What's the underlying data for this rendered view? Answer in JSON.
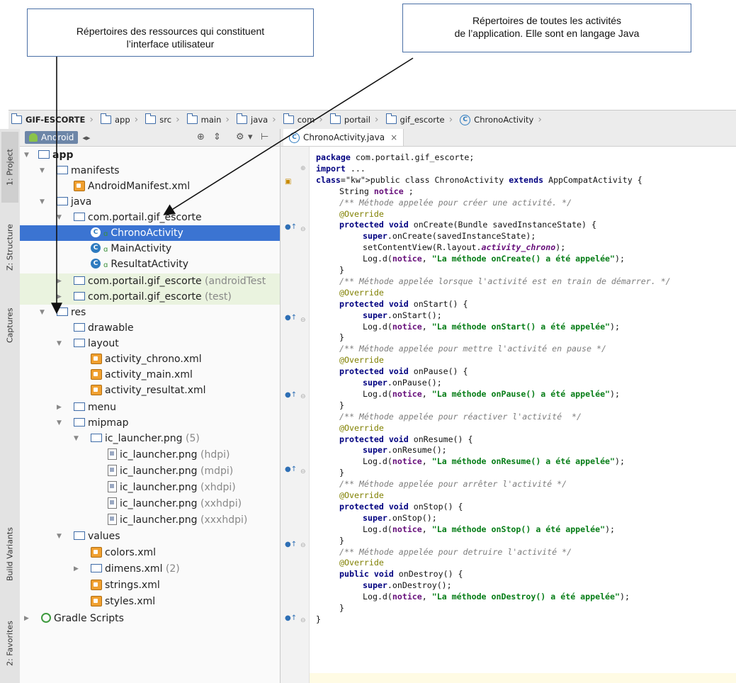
{
  "callouts": {
    "left": [
      "Répertoires des ressources qui constituent",
      "l’interface utilisateur"
    ],
    "right": [
      "Répertoires de toutes les activités",
      "de l’application. Elle sont en langage Java"
    ]
  },
  "breadcrumb": [
    {
      "label": "GIF-ESCORTE",
      "icon": "folder-icon"
    },
    {
      "label": "app",
      "icon": "folder-icon"
    },
    {
      "label": "src",
      "icon": "folder-icon"
    },
    {
      "label": "main",
      "icon": "folder-icon"
    },
    {
      "label": "java",
      "icon": "folder-icon"
    },
    {
      "label": "com",
      "icon": "folder-icon"
    },
    {
      "label": "portail",
      "icon": "folder-icon"
    },
    {
      "label": "gif_escorte",
      "icon": "folder-icon"
    },
    {
      "label": "ChronoActivity",
      "icon": "class-icon"
    }
  ],
  "tool_strip": {
    "project": "1: Project",
    "structure": "Z: Structure",
    "captures": "Captures",
    "build_variants": "Build Variants",
    "favorites": "2: Favorites"
  },
  "project_toolbar": {
    "view": "Android",
    "view_arrows": "◂▸"
  },
  "tree": {
    "app": "app",
    "manifests": "manifests",
    "android_manifest": "AndroidManifest.xml",
    "java": "java",
    "pkg_main": "com.portail.gif_escorte",
    "chrono": "ChronoActivity",
    "main_activity": "MainActivity",
    "resultat": "ResultatActivity",
    "pkg_android_test": "com.portail.gif_escorte",
    "pkg_android_test_suffix": "(androidTest",
    "pkg_test": "com.portail.gif_escorte",
    "pkg_test_suffix": "(test)",
    "res": "res",
    "drawable": "drawable",
    "layout": "layout",
    "layout_chrono": "activity_chrono.xml",
    "layout_main": "activity_main.xml",
    "layout_resultat": "activity_resultat.xml",
    "menu": "menu",
    "mipmap": "mipmap",
    "ic_launcher_group": "ic_launcher.png",
    "ic_launcher_count": "(5)",
    "ic_files": [
      {
        "name": "ic_launcher.png",
        "density": "(hdpi)"
      },
      {
        "name": "ic_launcher.png",
        "density": "(mdpi)"
      },
      {
        "name": "ic_launcher.png",
        "density": "(xhdpi)"
      },
      {
        "name": "ic_launcher.png",
        "density": "(xxhdpi)"
      },
      {
        "name": "ic_launcher.png",
        "density": "(xxxhdpi)"
      }
    ],
    "values": "values",
    "colors": "colors.xml",
    "dimens": "dimens.xml",
    "dimens_count": "(2)",
    "strings": "strings.xml",
    "styles": "styles.xml",
    "gradle": "Gradle Scripts"
  },
  "editor": {
    "tab_label": "ChronoActivity.java",
    "tab_close": "×"
  },
  "code": {
    "l1": "package com.portail.gif_escorte;",
    "l2": "import ...",
    "l3": "public class ChronoActivity extends AppCompatActivity {",
    "l4": "String notice ;",
    "c_create": "/** Méthode appelée pour créer une activité. */",
    "c_start": "/** Méthode appelée lorsque l'activité est en train de démarrer. */",
    "c_pause": "/** Méthode appelée pour mettre l'activité en pause */",
    "c_resume": "/** Méthode appelée pour réactiver l'activité  */",
    "c_stop": "/** Méthode appelée pour arrêter l'activité */",
    "c_destroy": "/** Méthode appelée pour detruire l'activité */",
    "override": "@Override",
    "on_create_sig": "protected void onCreate(Bundle savedInstanceState) {",
    "on_create_super": "super.onCreate(savedInstanceState);",
    "set_content": "setContentView(R.layout.activity_chrono);",
    "log_create": "Log.d(notice, \"La méthode onCreate() a été appelée\");",
    "on_start_sig": "protected void onStart() {",
    "on_start_super": "super.onStart();",
    "log_start": "Log.d(notice, \"La méthode onStart() a été appelée\");",
    "on_pause_sig": "protected void onPause() {",
    "on_pause_super": "super.onPause();",
    "log_pause": "Log.d(notice, \"La méthode onPause() a été appelée\");",
    "on_resume_sig": "protected void onResume() {",
    "on_resume_super": "super.onResume();",
    "log_resume": "Log.d(notice, \"La méthode onResume() a été appelée\");",
    "on_stop_sig": "protected void onStop() {",
    "on_stop_super": "super.onStop();",
    "log_stop": "Log.d(notice, \"La méthode onStop() a été appelée\");",
    "on_destroy_sig": "public void onDestroy() {",
    "on_destroy_super": "super.onDestroy();",
    "log_destroy": "Log.d(notice, \"La méthode onDestroy() a été appelée\");",
    "close_brace": "}"
  },
  "colors": {
    "selection": "#3b74d2",
    "keyword": "#000080",
    "string": "#067d17",
    "comment": "#7d7d7d",
    "annotation": "#808000"
  }
}
